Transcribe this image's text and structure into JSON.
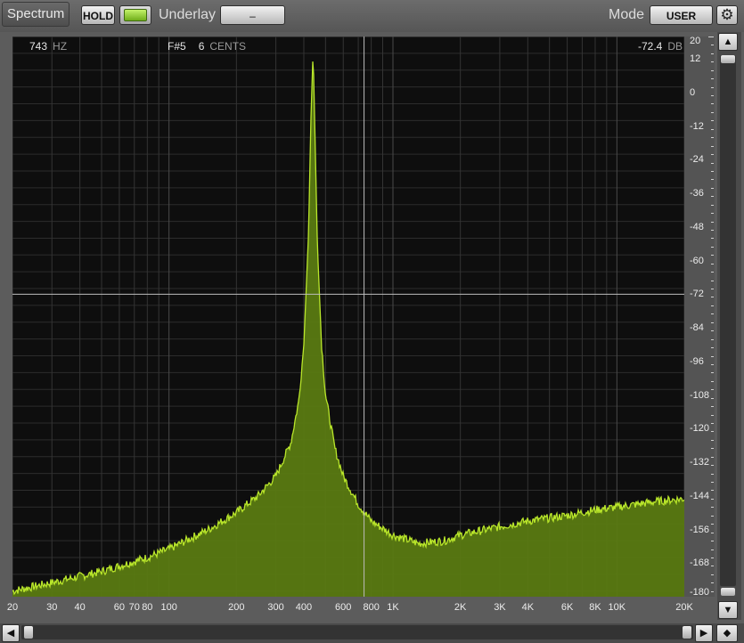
{
  "toolbar": {
    "title": "Spectrum",
    "hold_label": "HOLD",
    "underlay_label": "Underlay",
    "underlay_value": "–",
    "mode_label": "Mode",
    "mode_value": "USER"
  },
  "readout": {
    "freq_value": "743",
    "freq_unit": "HZ",
    "note": "F#5",
    "cents_value": "6",
    "cents_unit": "CENTS",
    "db_value": "-72.4",
    "db_unit": "DB"
  },
  "cursor": {
    "freq_hz": 743,
    "db": -72
  },
  "colors": {
    "spectrum_fill": "#5a7a12",
    "spectrum_line": "#b9e62a",
    "plot_bg": "#0e0e0e",
    "grid": "#3c3c3c"
  },
  "chart_data": {
    "type": "area",
    "xscale": "log",
    "xlim": [
      20,
      20000
    ],
    "ylim": [
      -180,
      20
    ],
    "x_ticks": [
      20,
      30,
      40,
      60,
      70,
      80,
      100,
      200,
      300,
      400,
      600,
      800,
      1000,
      2000,
      3000,
      4000,
      6000,
      8000,
      10000,
      20000
    ],
    "x_tick_labels": [
      "20",
      "30",
      "40",
      "60",
      "70",
      "80",
      "100",
      "200",
      "300",
      "400",
      "600",
      "800",
      "1K",
      "2K",
      "3K",
      "4K",
      "6K",
      "8K",
      "10K",
      "20K"
    ],
    "y_ticks": [
      20,
      12,
      0,
      -12,
      -24,
      -36,
      -48,
      -60,
      -72,
      -84,
      -96,
      -108,
      -120,
      -132,
      -144,
      -156,
      -168,
      -180
    ],
    "y_tick_labels": [
      "20",
      "12",
      "0",
      "-12",
      "-24",
      "-36",
      "-48",
      "-60",
      "-72",
      "-84",
      "-96",
      "-108",
      "-120",
      "-132",
      "-144",
      "-156",
      "-168",
      "-180"
    ],
    "series": [
      {
        "x": [
          20,
          30,
          50,
          80,
          100,
          150,
          200,
          250,
          300,
          350,
          380,
          400,
          420,
          430,
          440,
          450,
          460,
          480,
          500,
          550,
          600,
          700,
          800,
          1000,
          1300,
          1700,
          2000,
          3000,
          4000,
          6000,
          8000,
          10000,
          15000,
          20000
        ],
        "y": [
          -178,
          -175,
          -171,
          -166,
          -163,
          -156,
          -150,
          -144,
          -137,
          -125,
          -110,
          -90,
          -50,
          -10,
          15,
          -20,
          -55,
          -90,
          -108,
          -127,
          -137,
          -147,
          -153,
          -158,
          -161,
          -160,
          -158,
          -155,
          -153,
          -151,
          -149,
          -148,
          -146,
          -145
        ]
      }
    ]
  }
}
